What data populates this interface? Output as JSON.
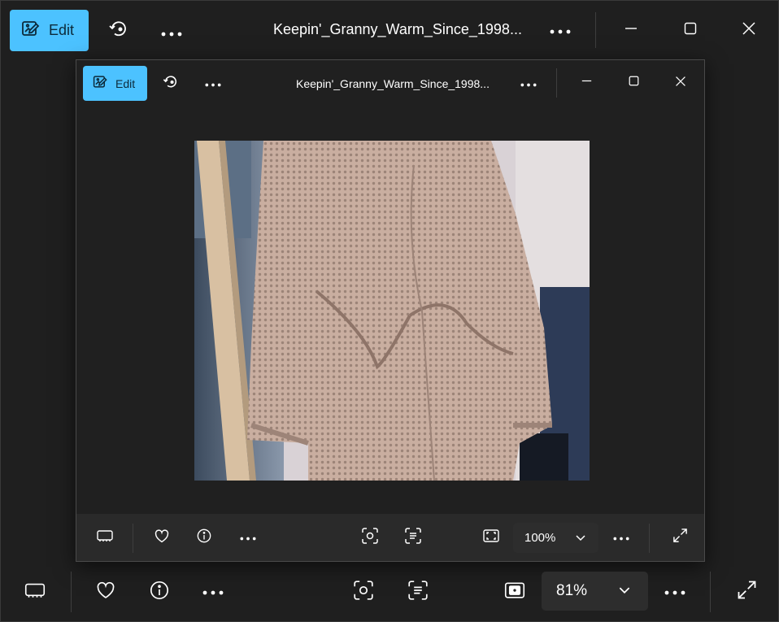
{
  "outer": {
    "edit_label": "Edit",
    "title": "Keepin'_Granny_Warm_Since_1998...",
    "zoom": "81%"
  },
  "inner": {
    "edit_label": "Edit",
    "title": "Keepin'_Granny_Warm_Since_1998...",
    "zoom": "100%"
  },
  "colors": {
    "accent": "#4cc2ff",
    "background": "#1f1f1f",
    "sweater": "#c8aea1"
  },
  "icons": [
    "edit-image-icon",
    "rotate-icon",
    "more-icon",
    "minimize-icon",
    "maximize-icon",
    "close-icon",
    "filmstrip-icon",
    "heart-icon",
    "info-icon",
    "visual-search-icon",
    "text-scan-icon",
    "fit-icon",
    "chevron-down-icon",
    "fullscreen-icon"
  ]
}
